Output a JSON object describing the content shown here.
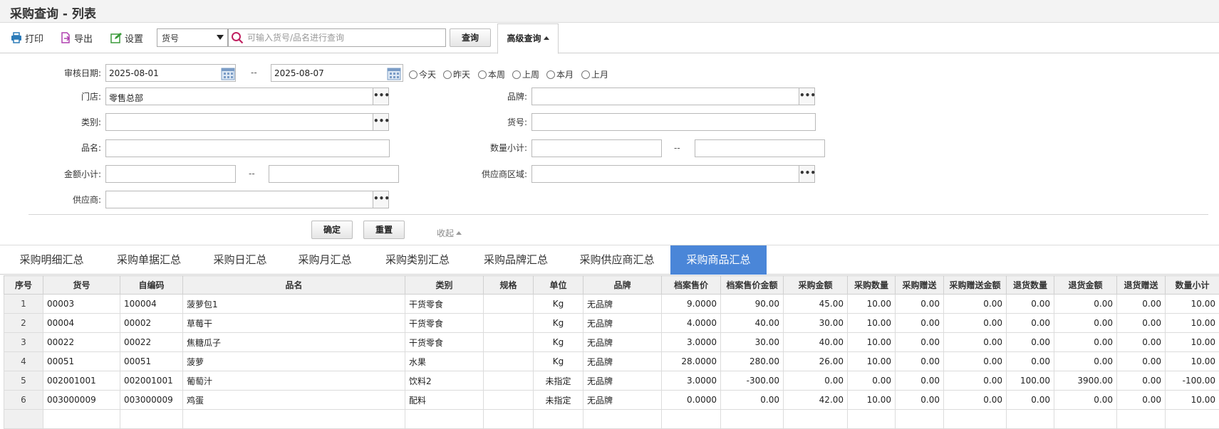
{
  "page": {
    "title": "采购查询 - 列表"
  },
  "toolbar": {
    "print_label": "打印",
    "export_label": "导出",
    "settings_label": "设置",
    "field_select": "货号",
    "search_placeholder": "可输入货号/品名进行查询",
    "query_label": "查询",
    "advanced_label": "高级查询"
  },
  "filters": {
    "audit_date_label": "审核日期:",
    "date_from": "2025-08-01",
    "date_to": "2025-08-07",
    "range_sep": "--",
    "quick_dates": [
      "今天",
      "昨天",
      "本周",
      "上周",
      "本月",
      "上月"
    ],
    "store_label": "门店:",
    "store_value": "零售总部",
    "brand_label": "品牌:",
    "brand_value": "",
    "category_label": "类别:",
    "category_value": "",
    "item_no_label": "货号:",
    "item_no_value": "",
    "name_label": "品名:",
    "name_value": "",
    "qty_subtotal_label": "数量小计:",
    "amount_subtotal_label": "金额小计:",
    "supplier_region_label": "供应商区域:",
    "supplier_label": "供应商:",
    "more_label": "•••",
    "confirm_label": "确定",
    "reset_label": "重置",
    "collapse_label": "收起"
  },
  "report_tabs": [
    "采购明细汇总",
    "采购单据汇总",
    "采购日汇总",
    "采购月汇总",
    "采购类别汇总",
    "采购品牌汇总",
    "采购供应商汇总",
    "采购商品汇总"
  ],
  "active_tab": 7,
  "table": {
    "columns": [
      "序号",
      "货号",
      "自编码",
      "品名",
      "类别",
      "规格",
      "单位",
      "品牌",
      "档案售价",
      "档案售价金额",
      "采购金额",
      "采购数量",
      "采购赠送",
      "采购赠送金额",
      "退货数量",
      "退货金额",
      "退货赠送",
      "数量小计"
    ],
    "rows": [
      [
        "1",
        "00003",
        "100004",
        "菠萝包1",
        "干货零食",
        "",
        "Kg",
        "无品牌",
        "9.0000",
        "90.00",
        "45.00",
        "10.00",
        "0.00",
        "0.00",
        "0.00",
        "0.00",
        "0.00",
        "10.00"
      ],
      [
        "2",
        "00004",
        "00002",
        "草莓干",
        "干货零食",
        "",
        "Kg",
        "无品牌",
        "4.0000",
        "40.00",
        "30.00",
        "10.00",
        "0.00",
        "0.00",
        "0.00",
        "0.00",
        "0.00",
        "10.00"
      ],
      [
        "3",
        "00022",
        "00022",
        "焦糖瓜子",
        "干货零食",
        "",
        "Kg",
        "无品牌",
        "3.0000",
        "30.00",
        "40.00",
        "10.00",
        "0.00",
        "0.00",
        "0.00",
        "0.00",
        "0.00",
        "10.00"
      ],
      [
        "4",
        "00051",
        "00051",
        "菠萝",
        "水果",
        "",
        "Kg",
        "无品牌",
        "28.0000",
        "280.00",
        "26.00",
        "10.00",
        "0.00",
        "0.00",
        "0.00",
        "0.00",
        "0.00",
        "10.00"
      ],
      [
        "5",
        "002001001",
        "002001001",
        "葡萄汁",
        "饮料2",
        "",
        "未指定",
        "无品牌",
        "3.0000",
        "-300.00",
        "0.00",
        "0.00",
        "0.00",
        "0.00",
        "100.00",
        "3900.00",
        "0.00",
        "-100.00"
      ],
      [
        "6",
        "003000009",
        "003000009",
        "鸡蛋",
        "配料",
        "",
        "未指定",
        "无品牌",
        "0.0000",
        "0.00",
        "42.00",
        "10.00",
        "0.00",
        "0.00",
        "0.00",
        "0.00",
        "0.00",
        "10.00"
      ]
    ]
  },
  "colors": {
    "accent": "#4a86d8",
    "print_icon": "#2b7bb9",
    "export_icon": "#b040b0",
    "settings_icon": "#3a9a3a"
  }
}
